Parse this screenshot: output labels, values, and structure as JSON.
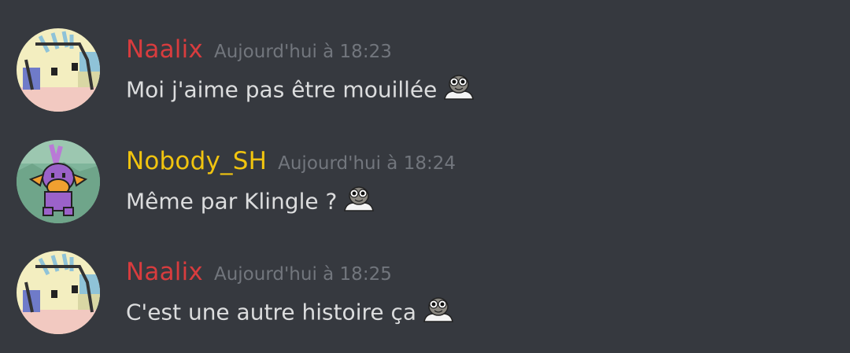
{
  "messages": [
    {
      "author": "Naalix",
      "author_color": "#d83c3e",
      "timestamp": "Aujourd'hui à 18:23",
      "text": "Moi j'aime pas être mouillée",
      "emoji": "gnome-emoji",
      "avatar": "pixel-pokemon-avatar"
    },
    {
      "author": "Nobody_SH",
      "author_color": "#f1c40f",
      "timestamp": "Aujourd'hui à 18:24",
      "text": "Même par Klingle ?",
      "emoji": "gnome-emoji",
      "avatar": "mudkip-avatar"
    },
    {
      "author": "Naalix",
      "author_color": "#d83c3e",
      "timestamp": "Aujourd'hui à 18:25",
      "text": "C'est une autre histoire ça",
      "emoji": "gnome-emoji",
      "avatar": "pixel-pokemon-avatar"
    }
  ],
  "colors": {
    "background": "#36393f",
    "text": "#dcddde",
    "timestamp": "#72767d"
  }
}
